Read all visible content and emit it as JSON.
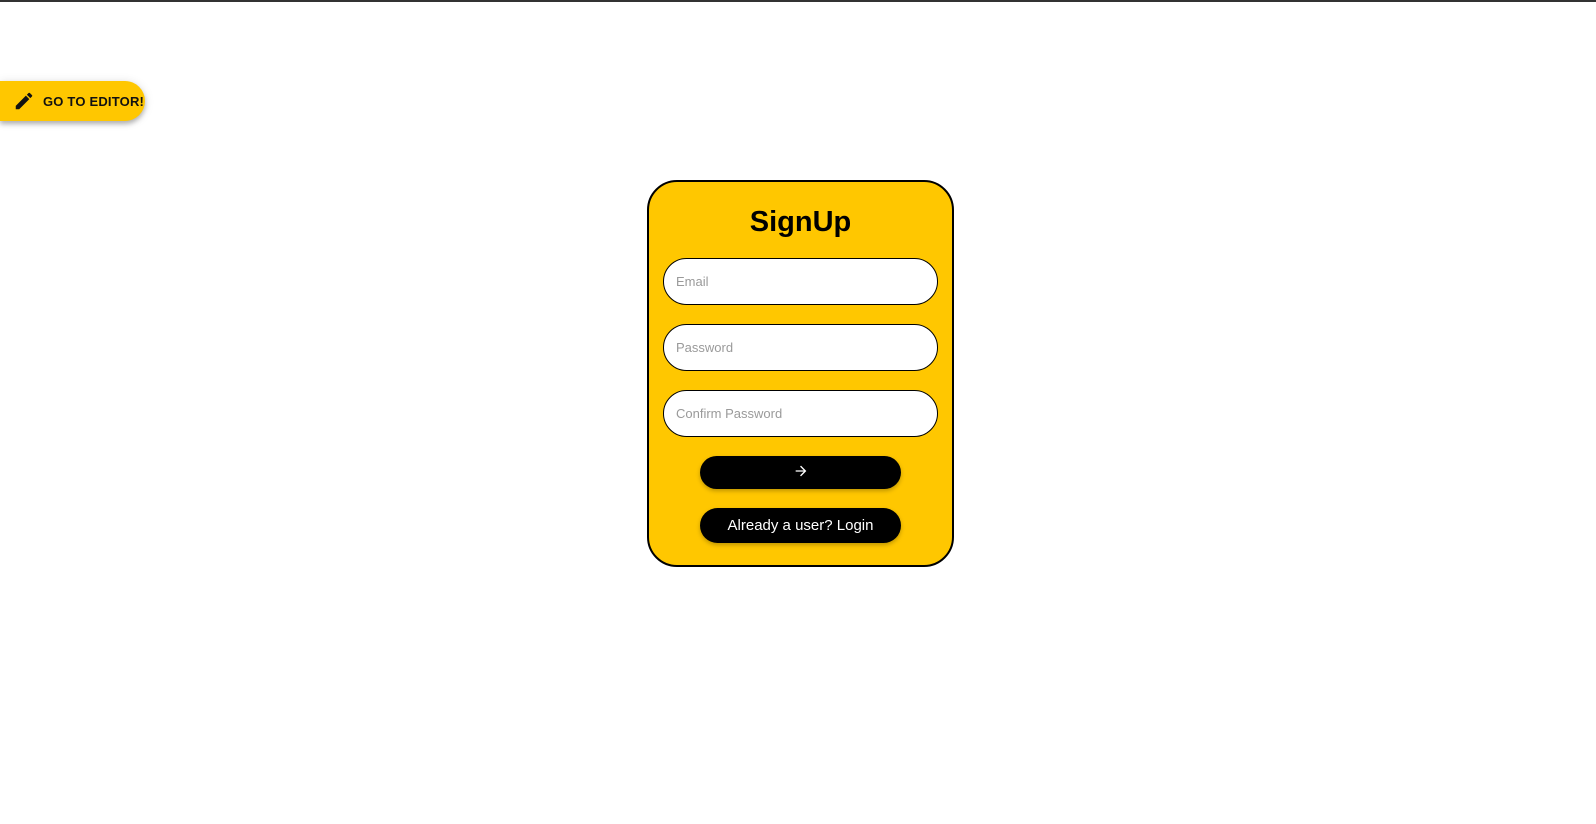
{
  "colors": {
    "accent": "#FFC700",
    "button": "#000000",
    "button_text": "#ffffff",
    "page_bg": "#ffffff"
  },
  "editor_button": {
    "icon": "pencil-icon",
    "label": "GO TO EDITOR!"
  },
  "signup": {
    "title": "SignUp",
    "email": {
      "placeholder": "Email",
      "value": ""
    },
    "password": {
      "placeholder": "Password",
      "value": ""
    },
    "confirm_password": {
      "placeholder": "Confirm Password",
      "value": ""
    },
    "submit_icon": "arrow-right-icon",
    "login_link_label": "Already a user? Login"
  }
}
